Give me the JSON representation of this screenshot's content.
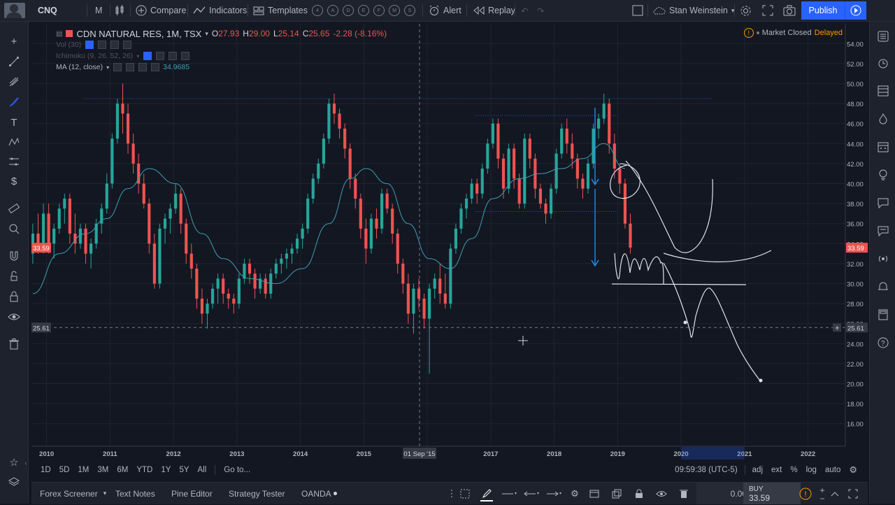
{
  "toolbar": {
    "symbol": "CNQ",
    "interval": "M",
    "compare": "Compare",
    "indicators": "Indicators",
    "templates": "Templates",
    "template_circles": [
      "4",
      "A",
      "D",
      "E",
      "F",
      "M",
      "S"
    ],
    "alert": "Alert",
    "replay": "Replay",
    "user": "Stan Weinstein",
    "publish": "Publish"
  },
  "legend": {
    "title": "CDN NATURAL RES, 1M, TSX",
    "open_label": "O",
    "open": "27.93",
    "high_label": "H",
    "high": "29.00",
    "low_label": "L",
    "low": "25.14",
    "close_label": "C",
    "close": "25.65",
    "change": "-2.28 (-8.16%)",
    "vol": "Vol (30)",
    "ichimoku": "Ichimoku (9, 26, 52, 26)",
    "ma": "MA (12, close)",
    "ma_value": "34.9685"
  },
  "status": {
    "market": "Market Closed",
    "delayed": "Delayed"
  },
  "price_axis": {
    "ticks": [
      "54.00",
      "52.00",
      "50.00",
      "48.00",
      "46.00",
      "44.00",
      "42.00",
      "40.00",
      "38.00",
      "36.00",
      "34.00",
      "32.00",
      "30.00",
      "28.00",
      "26.00",
      "24.00",
      "22.00",
      "20.00",
      "18.00",
      "16.00"
    ],
    "current_label": "33.59",
    "cross_label": "25.61",
    "current": 33.59,
    "cross": 25.61
  },
  "time_axis": {
    "labels": [
      "2010",
      "2011",
      "2012",
      "2013",
      "2014",
      "2015",
      "2016",
      "2017",
      "2018",
      "2019",
      "2020",
      "2021",
      "2022"
    ],
    "crosshair_label": "01 Sep '15"
  },
  "range_bar": {
    "ranges": [
      "1D",
      "5D",
      "1M",
      "3M",
      "6M",
      "YTD",
      "1Y",
      "5Y",
      "All"
    ],
    "goto": "Go to...",
    "clock": "09:59:38 (UTC-5)",
    "options": [
      "adj",
      "ext",
      "%",
      "log",
      "auto"
    ]
  },
  "bottom_bar": {
    "tabs": [
      "Forex Screener",
      "Text Notes",
      "Pine Editor",
      "Strategy Tester",
      "OANDA"
    ],
    "amount": "0.00",
    "buy_label": "BUY",
    "buy_price": "33.59"
  },
  "colors": {
    "up": "#26a69a",
    "down": "#ef5350",
    "ma": "#3d9fb0",
    "accent": "#2962ff",
    "bg": "#131722"
  },
  "chart_data": {
    "type": "candlestick",
    "symbol": "CDN NATURAL RES",
    "interval": "1M",
    "exchange": "TSX",
    "ylim": [
      15,
      55
    ],
    "xlim": [
      2009.85,
      2022.5
    ],
    "last_bar": {
      "date": "2018-11",
      "open": 27.93,
      "high": 29.0,
      "low": 25.14,
      "close": 25.65
    },
    "candles": [
      {
        "t": "2009-10",
        "o": 33,
        "h": 36,
        "l": 32,
        "c": 35
      },
      {
        "t": "2009-11",
        "o": 35,
        "h": 37,
        "l": 33,
        "c": 34
      },
      {
        "t": "2009-12",
        "o": 34,
        "h": 38,
        "l": 33,
        "c": 37
      },
      {
        "t": "2010-01",
        "o": 37,
        "h": 38,
        "l": 33,
        "c": 34
      },
      {
        "t": "2010-02",
        "o": 34,
        "h": 36,
        "l": 32.5,
        "c": 35.5
      },
      {
        "t": "2010-03",
        "o": 35.5,
        "h": 38,
        "l": 35,
        "c": 37.5
      },
      {
        "t": "2010-04",
        "o": 37.5,
        "h": 39,
        "l": 36,
        "c": 38.5
      },
      {
        "t": "2010-05",
        "o": 38.5,
        "h": 39,
        "l": 34,
        "c": 35
      },
      {
        "t": "2010-06",
        "o": 35,
        "h": 37,
        "l": 33,
        "c": 34
      },
      {
        "t": "2010-07",
        "o": 34,
        "h": 36,
        "l": 33.5,
        "c": 35.5
      },
      {
        "t": "2010-08",
        "o": 35.5,
        "h": 36,
        "l": 32,
        "c": 33
      },
      {
        "t": "2010-09",
        "o": 33,
        "h": 34.5,
        "l": 31.5,
        "c": 34
      },
      {
        "t": "2010-10",
        "o": 34,
        "h": 36.5,
        "l": 33.5,
        "c": 36
      },
      {
        "t": "2010-11",
        "o": 36,
        "h": 38,
        "l": 35,
        "c": 37.5
      },
      {
        "t": "2010-12",
        "o": 37.5,
        "h": 41,
        "l": 37,
        "c": 40
      },
      {
        "t": "2011-01",
        "o": 40,
        "h": 45,
        "l": 39.5,
        "c": 44.5
      },
      {
        "t": "2011-02",
        "o": 44.5,
        "h": 48.5,
        "l": 44,
        "c": 48
      },
      {
        "t": "2011-03",
        "o": 48,
        "h": 50,
        "l": 45,
        "c": 47
      },
      {
        "t": "2011-04",
        "o": 47,
        "h": 48,
        "l": 43,
        "c": 44
      },
      {
        "t": "2011-05",
        "o": 44,
        "h": 45,
        "l": 41,
        "c": 42
      },
      {
        "t": "2011-06",
        "o": 42,
        "h": 43,
        "l": 39,
        "c": 40
      },
      {
        "t": "2011-07",
        "o": 40,
        "h": 41,
        "l": 37.5,
        "c": 38
      },
      {
        "t": "2011-08",
        "o": 38,
        "h": 38.5,
        "l": 33,
        "c": 34
      },
      {
        "t": "2011-09",
        "o": 34,
        "h": 35,
        "l": 29.5,
        "c": 30
      },
      {
        "t": "2011-10",
        "o": 30,
        "h": 36,
        "l": 29.5,
        "c": 35.5
      },
      {
        "t": "2011-11",
        "o": 35.5,
        "h": 37,
        "l": 34,
        "c": 36.5
      },
      {
        "t": "2011-12",
        "o": 36.5,
        "h": 38,
        "l": 35,
        "c": 37.5
      },
      {
        "t": "2012-01",
        "o": 37.5,
        "h": 40,
        "l": 37,
        "c": 39
      },
      {
        "t": "2012-02",
        "o": 39,
        "h": 39.5,
        "l": 35,
        "c": 36
      },
      {
        "t": "2012-03",
        "o": 36,
        "h": 36.5,
        "l": 32,
        "c": 33
      },
      {
        "t": "2012-04",
        "o": 33,
        "h": 34,
        "l": 30.5,
        "c": 31.5
      },
      {
        "t": "2012-05",
        "o": 31.5,
        "h": 32,
        "l": 27.5,
        "c": 28.5
      },
      {
        "t": "2012-06",
        "o": 28.5,
        "h": 29.5,
        "l": 26,
        "c": 27
      },
      {
        "t": "2012-07",
        "o": 27,
        "h": 28.5,
        "l": 25.5,
        "c": 28
      },
      {
        "t": "2012-08",
        "o": 28,
        "h": 30,
        "l": 27.5,
        "c": 29.5
      },
      {
        "t": "2012-09",
        "o": 29.5,
        "h": 31,
        "l": 28,
        "c": 30.5
      },
      {
        "t": "2012-10",
        "o": 30.5,
        "h": 31,
        "l": 28,
        "c": 29
      },
      {
        "t": "2012-11",
        "o": 29,
        "h": 29.5,
        "l": 27.5,
        "c": 28.5
      },
      {
        "t": "2012-12",
        "o": 28.5,
        "h": 29,
        "l": 27,
        "c": 28
      },
      {
        "t": "2013-01",
        "o": 28,
        "h": 31,
        "l": 27.5,
        "c": 30.5
      },
      {
        "t": "2013-02",
        "o": 30.5,
        "h": 32.5,
        "l": 30,
        "c": 32
      },
      {
        "t": "2013-03",
        "o": 32,
        "h": 32.5,
        "l": 30,
        "c": 31
      },
      {
        "t": "2013-04",
        "o": 31,
        "h": 31.5,
        "l": 28.5,
        "c": 29.5
      },
      {
        "t": "2013-05",
        "o": 29.5,
        "h": 31,
        "l": 29,
        "c": 30.5
      },
      {
        "t": "2013-06",
        "o": 30.5,
        "h": 31,
        "l": 28.5,
        "c": 29
      },
      {
        "t": "2013-07",
        "o": 29,
        "h": 31.5,
        "l": 28.5,
        "c": 31
      },
      {
        "t": "2013-08",
        "o": 31,
        "h": 32.5,
        "l": 30.5,
        "c": 32
      },
      {
        "t": "2013-09",
        "o": 32,
        "h": 33,
        "l": 31,
        "c": 32.5
      },
      {
        "t": "2013-10",
        "o": 32.5,
        "h": 33.5,
        "l": 31.5,
        "c": 33
      },
      {
        "t": "2013-11",
        "o": 33,
        "h": 34,
        "l": 32,
        "c": 33.5
      },
      {
        "t": "2013-12",
        "o": 33.5,
        "h": 35,
        "l": 33,
        "c": 34.5
      },
      {
        "t": "2014-01",
        "o": 34.5,
        "h": 36,
        "l": 33.5,
        "c": 35.5
      },
      {
        "t": "2014-02",
        "o": 35.5,
        "h": 39,
        "l": 35,
        "c": 38.5
      },
      {
        "t": "2014-03",
        "o": 38.5,
        "h": 41,
        "l": 38,
        "c": 40.5
      },
      {
        "t": "2014-04",
        "o": 40.5,
        "h": 42.5,
        "l": 40,
        "c": 42
      },
      {
        "t": "2014-05",
        "o": 42,
        "h": 45,
        "l": 41.5,
        "c": 44.5
      },
      {
        "t": "2014-06",
        "o": 44.5,
        "h": 48.5,
        "l": 44,
        "c": 48
      },
      {
        "t": "2014-07",
        "o": 48,
        "h": 49,
        "l": 46,
        "c": 47
      },
      {
        "t": "2014-08",
        "o": 47,
        "h": 47.5,
        "l": 44.5,
        "c": 45.5
      },
      {
        "t": "2014-09",
        "o": 45.5,
        "h": 46,
        "l": 42.5,
        "c": 43.5
      },
      {
        "t": "2014-10",
        "o": 43.5,
        "h": 44,
        "l": 39.5,
        "c": 40.5
      },
      {
        "t": "2014-11",
        "o": 40.5,
        "h": 41,
        "l": 37.5,
        "c": 38.5
      },
      {
        "t": "2014-12",
        "o": 38.5,
        "h": 39,
        "l": 34.5,
        "c": 35.5
      },
      {
        "t": "2015-01",
        "o": 35.5,
        "h": 36.5,
        "l": 32,
        "c": 33.5
      },
      {
        "t": "2015-02",
        "o": 33.5,
        "h": 37,
        "l": 33,
        "c": 36.5
      },
      {
        "t": "2015-03",
        "o": 36.5,
        "h": 37.5,
        "l": 34.5,
        "c": 35.5
      },
      {
        "t": "2015-04",
        "o": 35.5,
        "h": 39.5,
        "l": 35,
        "c": 39
      },
      {
        "t": "2015-05",
        "o": 39,
        "h": 39.5,
        "l": 37,
        "c": 37.5
      },
      {
        "t": "2015-06",
        "o": 37.5,
        "h": 38,
        "l": 34,
        "c": 35
      },
      {
        "t": "2015-07",
        "o": 35,
        "h": 35.5,
        "l": 31,
        "c": 32
      },
      {
        "t": "2015-08",
        "o": 32,
        "h": 32.5,
        "l": 29,
        "c": 30
      },
      {
        "t": "2015-09",
        "o": 30,
        "h": 31,
        "l": 26,
        "c": 27
      },
      {
        "t": "2015-10",
        "o": 27,
        "h": 30,
        "l": 25,
        "c": 29.5
      },
      {
        "t": "2015-11",
        "o": 29.5,
        "h": 30.5,
        "l": 27.5,
        "c": 28.5
      },
      {
        "t": "2015-12",
        "o": 28.5,
        "h": 29,
        "l": 25.5,
        "c": 26.5
      },
      {
        "t": "2016-01",
        "o": 26.5,
        "h": 30,
        "l": 21,
        "c": 29.5
      },
      {
        "t": "2016-02",
        "o": 29.5,
        "h": 31,
        "l": 28.5,
        "c": 30.5
      },
      {
        "t": "2016-03",
        "o": 30.5,
        "h": 32,
        "l": 28,
        "c": 29
      },
      {
        "t": "2016-04",
        "o": 29,
        "h": 31,
        "l": 27.5,
        "c": 28
      },
      {
        "t": "2016-05",
        "o": 28,
        "h": 34,
        "l": 27.5,
        "c": 33.5
      },
      {
        "t": "2016-06",
        "o": 33.5,
        "h": 36,
        "l": 33,
        "c": 35.5
      },
      {
        "t": "2016-07",
        "o": 35.5,
        "h": 38,
        "l": 35,
        "c": 37.5
      },
      {
        "t": "2016-08",
        "o": 37.5,
        "h": 39,
        "l": 36.5,
        "c": 38.5
      },
      {
        "t": "2016-09",
        "o": 38.5,
        "h": 40.5,
        "l": 38,
        "c": 40
      },
      {
        "t": "2016-10",
        "o": 40,
        "h": 40.5,
        "l": 38,
        "c": 39
      },
      {
        "t": "2016-11",
        "o": 39,
        "h": 42,
        "l": 38.5,
        "c": 41.5
      },
      {
        "t": "2016-12",
        "o": 41.5,
        "h": 44.5,
        "l": 41,
        "c": 44
      },
      {
        "t": "2017-01",
        "o": 44,
        "h": 46.5,
        "l": 43.5,
        "c": 46
      },
      {
        "t": "2017-02",
        "o": 46,
        "h": 46.5,
        "l": 41.5,
        "c": 42.5
      },
      {
        "t": "2017-03",
        "o": 42.5,
        "h": 43,
        "l": 38.5,
        "c": 39.5
      },
      {
        "t": "2017-04",
        "o": 39.5,
        "h": 44,
        "l": 39,
        "c": 43.5
      },
      {
        "t": "2017-05",
        "o": 43.5,
        "h": 44,
        "l": 39.5,
        "c": 40.5
      },
      {
        "t": "2017-06",
        "o": 40.5,
        "h": 41,
        "l": 37.5,
        "c": 38
      },
      {
        "t": "2017-07",
        "o": 38,
        "h": 45,
        "l": 37.5,
        "c": 44.5
      },
      {
        "t": "2017-08",
        "o": 44.5,
        "h": 45,
        "l": 41.5,
        "c": 42.5
      },
      {
        "t": "2017-09",
        "o": 42.5,
        "h": 43,
        "l": 38.5,
        "c": 39.5
      },
      {
        "t": "2017-10",
        "o": 39.5,
        "h": 40,
        "l": 37.5,
        "c": 38
      },
      {
        "t": "2017-11",
        "o": 38,
        "h": 38.5,
        "l": 36,
        "c": 37
      },
      {
        "t": "2017-12",
        "o": 37,
        "h": 40,
        "l": 36.5,
        "c": 39.5
      },
      {
        "t": "2018-01",
        "o": 39.5,
        "h": 43.5,
        "l": 39,
        "c": 43
      },
      {
        "t": "2018-02",
        "o": 43,
        "h": 46,
        "l": 42.5,
        "c": 45.5
      },
      {
        "t": "2018-03",
        "o": 45.5,
        "h": 46.5,
        "l": 43,
        "c": 44
      },
      {
        "t": "2018-04",
        "o": 44,
        "h": 45,
        "l": 41.5,
        "c": 42.5
      },
      {
        "t": "2018-05",
        "o": 42.5,
        "h": 43,
        "l": 39.5,
        "c": 40.5
      },
      {
        "t": "2018-06",
        "o": 40.5,
        "h": 41,
        "l": 38.5,
        "c": 39.5
      },
      {
        "t": "2018-07",
        "o": 39.5,
        "h": 42.5,
        "l": 39,
        "c": 42
      },
      {
        "t": "2018-08",
        "o": 42,
        "h": 46,
        "l": 41.5,
        "c": 45.5
      },
      {
        "t": "2018-09",
        "o": 45.5,
        "h": 47,
        "l": 44.5,
        "c": 46.5
      },
      {
        "t": "2018-10",
        "o": 46.5,
        "h": 49,
        "l": 46,
        "c": 48
      },
      {
        "t": "2018-11",
        "o": 48,
        "h": 48.5,
        "l": 43,
        "c": 44
      },
      {
        "t": "2018-12",
        "o": 44,
        "h": 45,
        "l": 40.5,
        "c": 41.5
      },
      {
        "t": "2019-01",
        "o": 41.5,
        "h": 42,
        "l": 39,
        "c": 40
      },
      {
        "t": "2019-02",
        "o": 40,
        "h": 40.5,
        "l": 35.5,
        "c": 36
      },
      {
        "t": "2019-03",
        "o": 36,
        "h": 37,
        "l": 33,
        "c": 33.6
      }
    ],
    "ma_series": [
      {
        "t": "2009-10",
        "v": 29
      },
      {
        "t": "2010-03",
        "v": 33
      },
      {
        "t": "2010-08",
        "v": 35
      },
      {
        "t": "2010-12",
        "v": 36.5
      },
      {
        "t": "2011-04",
        "v": 39.5
      },
      {
        "t": "2011-08",
        "v": 41.5
      },
      {
        "t": "2012-01",
        "v": 40
      },
      {
        "t": "2012-06",
        "v": 35
      },
      {
        "t": "2012-10",
        "v": 32.5
      },
      {
        "t": "2013-03",
        "v": 30.5
      },
      {
        "t": "2013-08",
        "v": 30
      },
      {
        "t": "2014-01",
        "v": 31.5
      },
      {
        "t": "2014-06",
        "v": 36
      },
      {
        "t": "2014-10",
        "v": 40.5
      },
      {
        "t": "2015-01",
        "v": 41.5
      },
      {
        "t": "2015-05",
        "v": 40
      },
      {
        "t": "2015-09",
        "v": 36
      },
      {
        "t": "2016-01",
        "v": 32.5
      },
      {
        "t": "2016-05",
        "v": 31.5
      },
      {
        "t": "2016-09",
        "v": 34.5
      },
      {
        "t": "2017-01",
        "v": 38.5
      },
      {
        "t": "2017-06",
        "v": 40.5
      },
      {
        "t": "2017-10",
        "v": 41
      },
      {
        "t": "2018-02",
        "v": 41.5
      },
      {
        "t": "2018-06",
        "v": 42.5
      },
      {
        "t": "2018-10",
        "v": 44
      },
      {
        "t": "2019-02",
        "v": 41.5
      }
    ],
    "hlines": [
      {
        "from": "2010-08",
        "to": "2020-07",
        "v": 48.5
      },
      {
        "from": "2016-10",
        "to": "2019-01",
        "v": 46.8
      },
      {
        "from": "2016-10",
        "to": "2019-01",
        "v": 37.2
      }
    ]
  }
}
